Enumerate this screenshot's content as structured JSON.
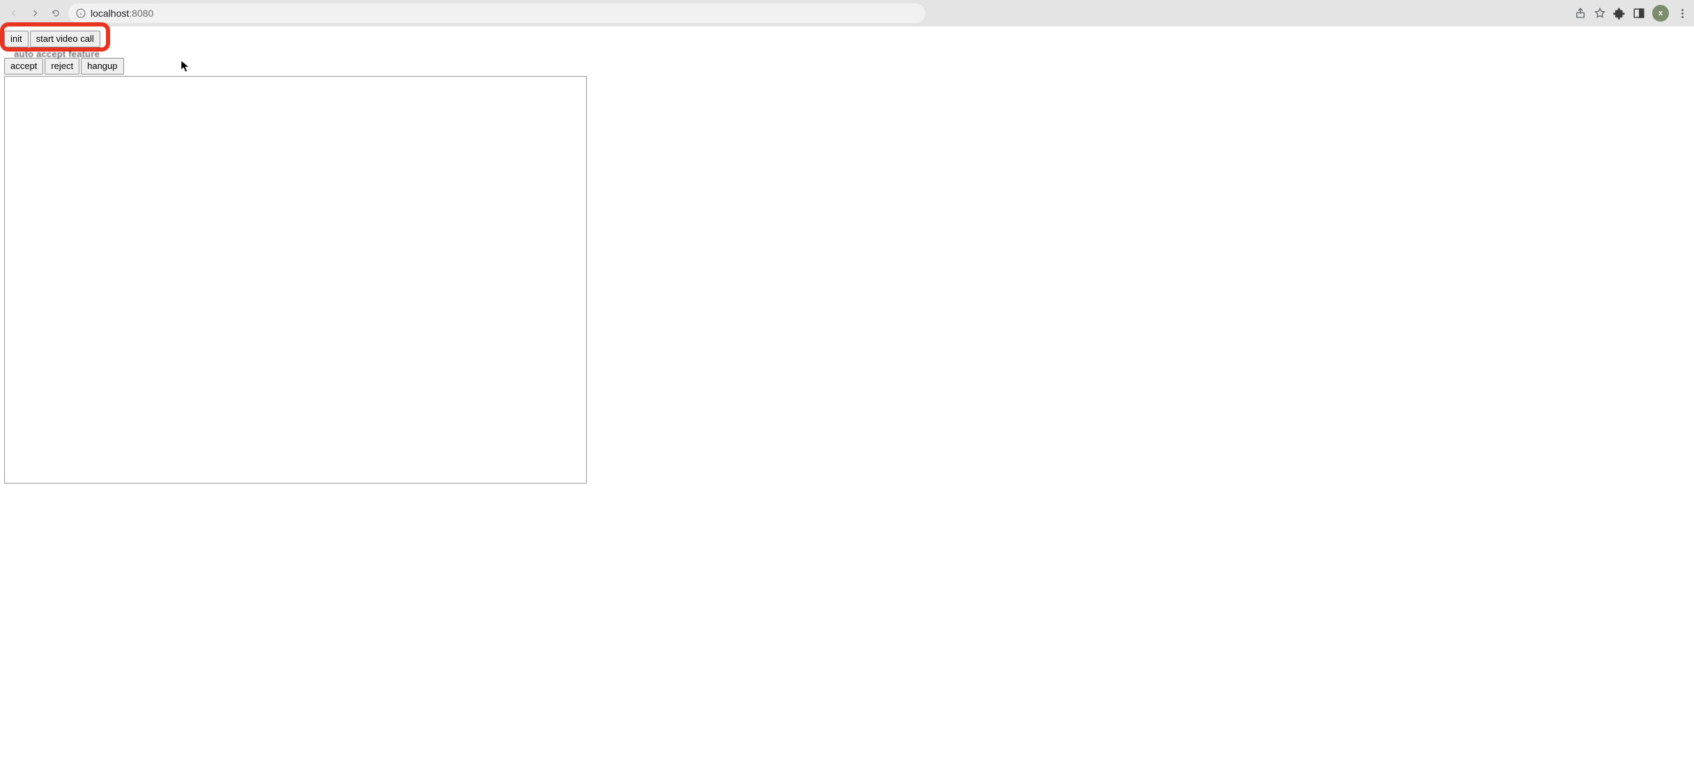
{
  "browser": {
    "url_host": "localhost",
    "url_port": ":8080",
    "avatar_initial": "x"
  },
  "buttons_row1": {
    "init": "init",
    "start_video_call": "start video call"
  },
  "status_text": "auto accept feature",
  "buttons_row2": {
    "accept": "accept",
    "reject": "reject",
    "hangup": "hangup"
  }
}
